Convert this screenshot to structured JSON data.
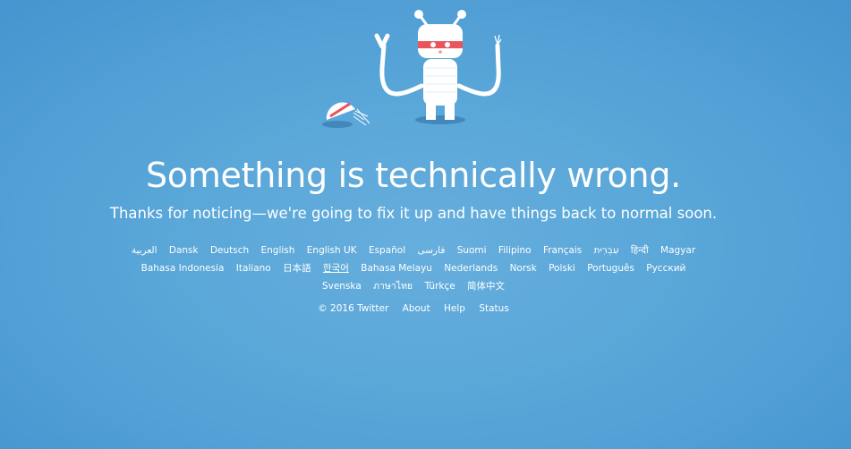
{
  "colors": {
    "background": "#58a6d8",
    "text": "#ffffff",
    "visor": "#e8555a"
  },
  "illustration": {
    "icon": "broken-robot-icon"
  },
  "headline": "Something is technically wrong.",
  "subline": "Thanks for noticing—we're going to fix it up and have things back to normal soon.",
  "languages": [
    "العربية",
    "Dansk",
    "Deutsch",
    "English",
    "English UK",
    "Español",
    "فارسی",
    "Suomi",
    "Filipino",
    "Français",
    "עִבְרִית",
    "हिन्दी",
    "Magyar",
    "Bahasa Indonesia",
    "Italiano",
    "日本語",
    "한국어",
    "Bahasa Melayu",
    "Nederlands",
    "Norsk",
    "Polski",
    "Português",
    "Русский",
    "Svenska",
    "ภาษาไทย",
    "Türkçe",
    "简体中文"
  ],
  "current_language": "한국어",
  "footer": {
    "copyright": "© 2016 Twitter",
    "about": "About",
    "help": "Help",
    "status": "Status"
  }
}
